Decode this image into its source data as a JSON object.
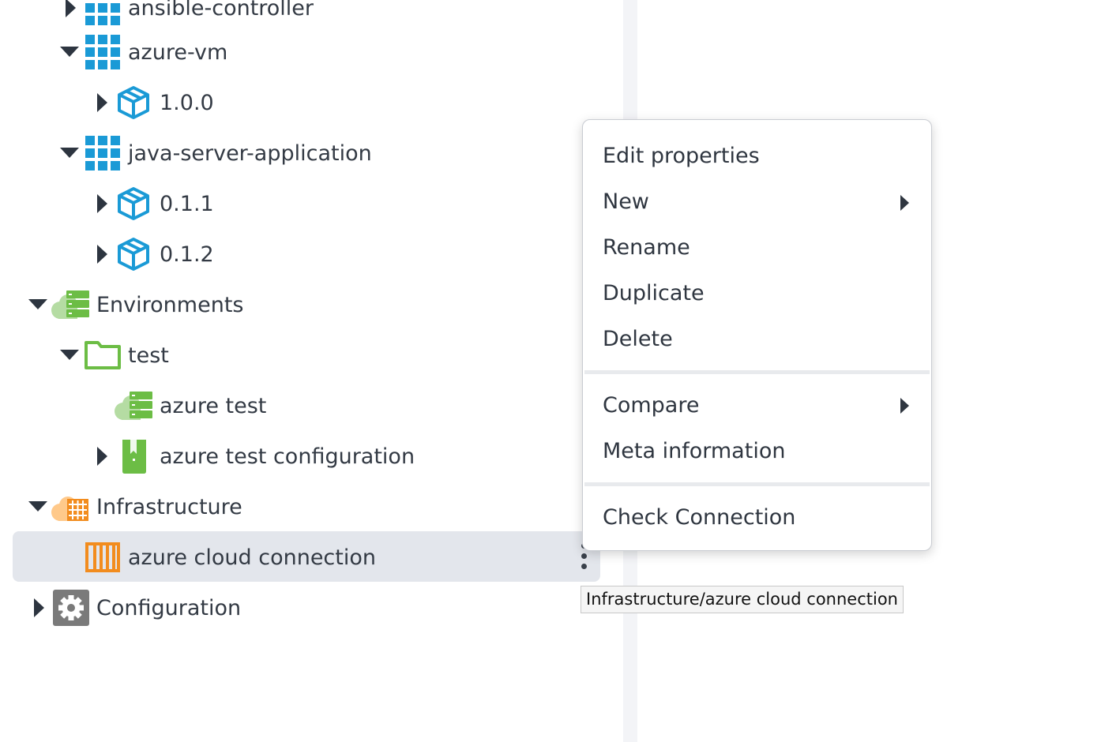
{
  "tree": {
    "items": [
      {
        "label": "ansible-controller",
        "icon": "grid-icon"
      },
      {
        "label": "azure-vm",
        "icon": "grid-icon"
      },
      {
        "label": "1.0.0",
        "icon": "package-icon"
      },
      {
        "label": "java-server-application",
        "icon": "grid-icon"
      },
      {
        "label": "0.1.1",
        "icon": "package-icon"
      },
      {
        "label": "0.1.2",
        "icon": "package-icon"
      },
      {
        "label": "Environments",
        "icon": "environment-cloud-icon"
      },
      {
        "label": "test",
        "icon": "folder-icon"
      },
      {
        "label": "azure test",
        "icon": "environment-cloud-icon"
      },
      {
        "label": "azure test configuration",
        "icon": "bookmark-icon"
      },
      {
        "label": "Infrastructure",
        "icon": "infrastructure-cloud-icon"
      },
      {
        "label": "azure cloud connection",
        "icon": "cloud-connection-icon"
      },
      {
        "label": "Configuration",
        "icon": "gear-icon"
      }
    ],
    "selected": "azure cloud connection"
  },
  "context_menu": {
    "items": [
      "Edit properties",
      "New",
      "Rename",
      "Duplicate",
      "Delete",
      "Compare",
      "Meta information",
      "Check Connection"
    ]
  },
  "tooltip": "Infrastructure/azure cloud connection",
  "colors": {
    "blue_icon": "#1a9ad6",
    "green_icon": "#6cbd45",
    "orange_icon": "#f28c1e",
    "gray_icon": "#7a7a7a",
    "selection": "#e3e6ec"
  }
}
